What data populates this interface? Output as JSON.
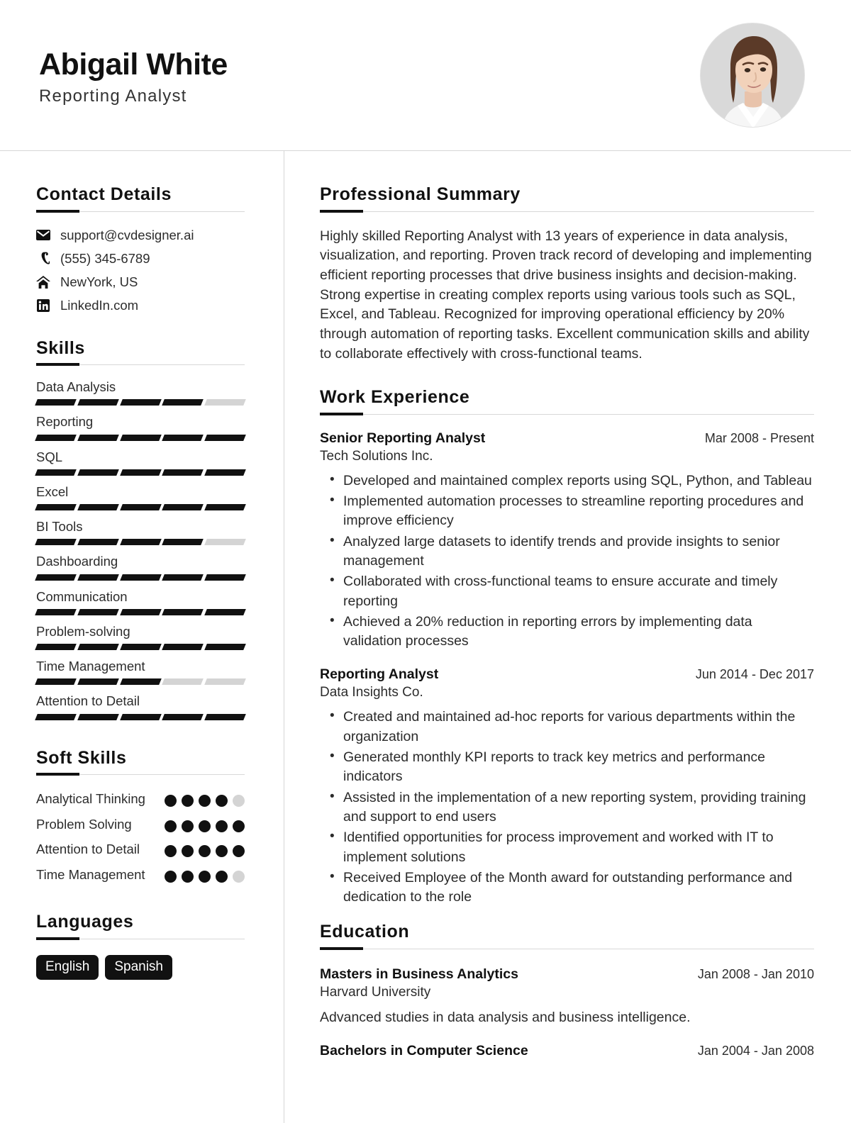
{
  "header": {
    "name": "Abigail White",
    "job_title": "Reporting Analyst",
    "avatar_alt": "profile-photo"
  },
  "sidebar": {
    "contact": {
      "heading": "Contact Details",
      "items": [
        {
          "icon": "email-icon",
          "value": "support@cvdesigner.ai"
        },
        {
          "icon": "phone-icon",
          "value": "(555) 345-6789"
        },
        {
          "icon": "home-icon",
          "value": "NewYork, US"
        },
        {
          "icon": "linkedin-icon",
          "value": "LinkedIn.com"
        }
      ]
    },
    "skills": {
      "heading": "Skills",
      "max": 5,
      "items": [
        {
          "name": "Data Analysis",
          "level": 4
        },
        {
          "name": "Reporting",
          "level": 5
        },
        {
          "name": "SQL",
          "level": 5
        },
        {
          "name": "Excel",
          "level": 5
        },
        {
          "name": "BI Tools",
          "level": 4
        },
        {
          "name": "Dashboarding",
          "level": 5
        },
        {
          "name": "Communication",
          "level": 5
        },
        {
          "name": "Problem-solving",
          "level": 5
        },
        {
          "name": "Time Management",
          "level": 3
        },
        {
          "name": "Attention to Detail",
          "level": 5
        }
      ]
    },
    "soft_skills": {
      "heading": "Soft Skills",
      "max": 5,
      "items": [
        {
          "name": "Analytical Thinking",
          "level": 4
        },
        {
          "name": "Problem Solving",
          "level": 5
        },
        {
          "name": "Attention to Detail",
          "level": 5
        },
        {
          "name": "Time Management",
          "level": 4
        }
      ]
    },
    "languages": {
      "heading": "Languages",
      "items": [
        "English",
        "Spanish"
      ]
    }
  },
  "main": {
    "summary": {
      "heading": "Professional Summary",
      "text": "Highly skilled Reporting Analyst with 13 years of experience in data analysis, visualization, and reporting. Proven track record of developing and implementing efficient reporting processes that drive business insights and decision-making. Strong expertise in creating complex reports using various tools such as SQL, Excel, and Tableau. Recognized for improving operational efficiency by 20% through automation of reporting tasks. Excellent communication skills and ability to collaborate effectively with cross-functional teams."
    },
    "experience": {
      "heading": "Work Experience",
      "entries": [
        {
          "title": "Senior Reporting Analyst",
          "date": "Mar 2008 - Present",
          "org": "Tech Solutions Inc.",
          "bullets": [
            "Developed and maintained complex reports using SQL, Python, and Tableau",
            "Implemented automation processes to streamline reporting procedures and improve efficiency",
            "Analyzed large datasets to identify trends and provide insights to senior management",
            "Collaborated with cross-functional teams to ensure accurate and timely reporting",
            "Achieved a 20% reduction in reporting errors by implementing data validation processes"
          ]
        },
        {
          "title": "Reporting Analyst",
          "date": "Jun 2014 - Dec 2017",
          "org": "Data Insights Co.",
          "bullets": [
            "Created and maintained ad-hoc reports for various departments within the organization",
            "Generated monthly KPI reports to track key metrics and performance indicators",
            "Assisted in the implementation of a new reporting system, providing training and support to end users",
            "Identified opportunities for process improvement and worked with IT to implement solutions",
            "Received Employee of the Month award for outstanding performance and dedication to the role"
          ]
        }
      ]
    },
    "education": {
      "heading": "Education",
      "entries": [
        {
          "title": "Masters in Business Analytics",
          "date": "Jan 2008 - Jan 2010",
          "org": "Harvard University",
          "desc": "Advanced studies in data analysis and business intelligence."
        },
        {
          "title": "Bachelors in Computer Science",
          "date": "Jan 2004 - Jan 2008",
          "org": "",
          "desc": ""
        }
      ]
    }
  },
  "colors": {
    "accent": "#111111",
    "rule": "#d8d8d8",
    "muted": "#d4d4d4",
    "text": "#2b2b2b"
  }
}
